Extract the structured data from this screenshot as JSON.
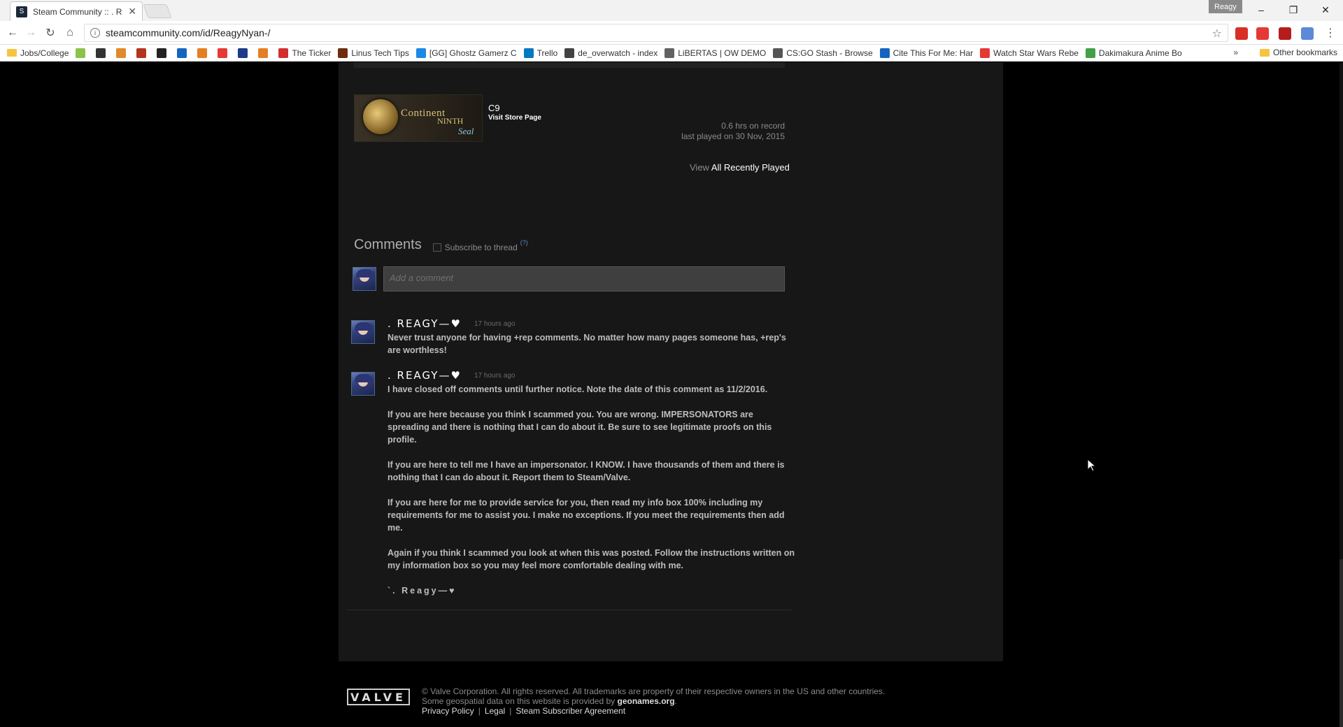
{
  "browser": {
    "tab_title": "Steam Community :: .  R",
    "tab_close": "✕",
    "profile_name": "Reagy",
    "url": "steamcommunity.com/id/ReagyNyan-/"
  },
  "bookmarks": {
    "items": [
      {
        "label": "Jobs/College",
        "color": "#f5c542"
      },
      {
        "label": "",
        "color": "#8bc34a"
      },
      {
        "label": "",
        "color": "#333333"
      },
      {
        "label": "",
        "color": "#e08a2a"
      },
      {
        "label": "",
        "color": "#b3361c"
      },
      {
        "label": "",
        "color": "#222222"
      },
      {
        "label": "",
        "color": "#1565c0"
      },
      {
        "label": "",
        "color": "#e67e22"
      },
      {
        "label": "",
        "color": "#e53935"
      },
      {
        "label": "",
        "color": "#1e3a8a"
      },
      {
        "label": "",
        "color": "#e67e22"
      },
      {
        "label": "The Ticker",
        "color": "#d32f2f"
      },
      {
        "label": "Linus Tech Tips",
        "color": "#6d2c0f"
      },
      {
        "label": "[GG] Ghostz Gamerz C",
        "color": "#1e88e5"
      },
      {
        "label": "Trello",
        "color": "#0079bf"
      },
      {
        "label": "de_overwatch - index",
        "color": "#424242"
      },
      {
        "label": "LiBERTAS | OW DEMO",
        "color": "#616161"
      },
      {
        "label": "CS:GO Stash - Browse",
        "color": "#555555"
      },
      {
        "label": "Cite This For Me: Har",
        "color": "#1565c0"
      },
      {
        "label": "Watch Star Wars Rebe",
        "color": "#e53935"
      },
      {
        "label": "Dakimakura Anime Bo",
        "color": "#43a047"
      }
    ],
    "other": "Other bookmarks",
    "overflow": "»"
  },
  "game": {
    "logo_line1": "Continent",
    "logo_line2": "NINTH",
    "logo_line3": "Seal",
    "name": "C9",
    "store_link": "Visit Store Page",
    "hours": "0.6 hrs on record",
    "last_played": "last played on 30 Nov, 2015"
  },
  "recent": {
    "view_prefix": "View",
    "view_link": "All Recently Played"
  },
  "comments": {
    "title": "Comments",
    "subscribe_label": "Subscribe to thread",
    "subscribe_help": "(?)",
    "input_placeholder": "Add a comment",
    "items": [
      {
        "author": ". REAGY—♥",
        "time": "17 hours ago",
        "paragraphs": [
          "Never trust anyone for having +rep comments. No matter how many pages someone has, +rep's are worthless!"
        ]
      },
      {
        "author": ". REAGY—♥",
        "time": "17 hours ago",
        "paragraphs": [
          "I have closed off comments until further notice. Note the date of this comment as 11/2/2016.",
          "If you are here because you think I scammed you. You are wrong. IMPERSONATORS are spreading and there is nothing that I can do about it. Be sure to see legitimate proofs on this profile.",
          "If you are here to tell me I have an impersonator. I KNOW. I have thousands of them and there is nothing that I can do about it. Report them to Steam/Valve.",
          "If you are here for me to provide service for you, then read my info box 100% including my requirements for me to assist you. I make no exceptions. If you meet the requirements then add me.",
          "Again if you think I scammed you look at when this was posted. Follow the instructions written on my information box so you may feel more comfortable dealing with me.",
          "`. Reagy—♥"
        ]
      }
    ]
  },
  "footer": {
    "logo": "VALVE",
    "line1": "© Valve Corporation. All rights reserved. All trademarks are property of their respective owners in the US and other countries.",
    "line2_prefix": "Some geospatial data on this website is provided by",
    "line2_link": "geonames.org",
    "line2_suffix": ".",
    "links": [
      "Privacy Policy",
      "Legal",
      "Steam Subscriber Agreement"
    ],
    "link_sep": "|"
  }
}
